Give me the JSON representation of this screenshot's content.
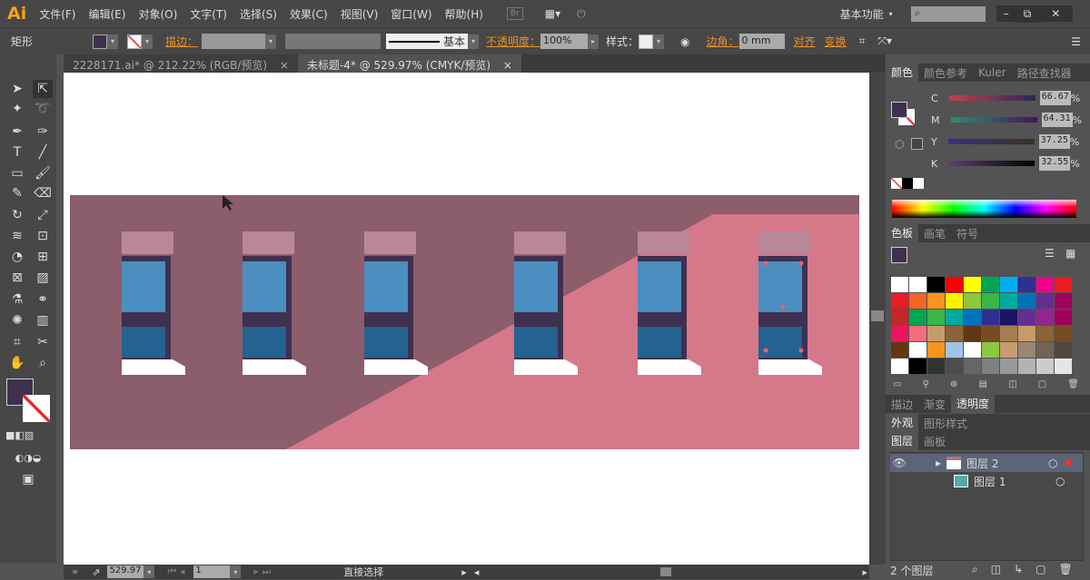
{
  "app": {
    "logo": "Ai",
    "menus": [
      "文件(F)",
      "编辑(E)",
      "对象(O)",
      "文字(T)",
      "选择(S)",
      "效果(C)",
      "视图(V)",
      "窗口(W)",
      "帮助(H)"
    ],
    "bridge": "Br",
    "workspace": "基本功能",
    "search_placeholder": ""
  },
  "control": {
    "object_type": "矩形",
    "stroke_label": "描边：",
    "brush": "基本",
    "opacity_label": "不透明度：",
    "opacity": "100%",
    "style_label": "样式：",
    "corner_label": "边角：",
    "corner_value": "0 mm",
    "align": "对齐",
    "transform": "变换"
  },
  "tabs": [
    {
      "label": "2228171.ai* @ 212.22% (RGB/预览)",
      "close": "×"
    },
    {
      "label": "未标题-4* @ 529.97% (CMYK/预览)",
      "close": "×"
    }
  ],
  "color_panel": {
    "tabs": [
      "颜色",
      "颜色参考",
      "Kuler",
      "路径查找器"
    ],
    "channels": [
      {
        "name": "C",
        "value": "66.67",
        "pct": "%"
      },
      {
        "name": "M",
        "value": "64.31",
        "pct": "%"
      },
      {
        "name": "Y",
        "value": "37.25",
        "pct": "%"
      },
      {
        "name": "K",
        "value": "32.55",
        "pct": "%"
      }
    ],
    "fill": "#3f3050"
  },
  "swatch_panel": {
    "tabs": [
      "色板",
      "画笔",
      "符号"
    ],
    "colors": [
      "#ffffff",
      "#ffffff",
      "#000000",
      "#ff0000",
      "#ffff00",
      "#00a651",
      "#00aeef",
      "#2e3192",
      "#ec008c",
      "#ed1c24",
      "#ed1c24",
      "#f26522",
      "#f7941d",
      "#fff200",
      "#8dc63f",
      "#39b54a",
      "#00a99d",
      "#0072bc",
      "#662d91",
      "#9e005d",
      "#c1272d",
      "#00a651",
      "#39b54a",
      "#00a99d",
      "#0072bc",
      "#2e3192",
      "#1b1464",
      "#662d91",
      "#92278f",
      "#9e005d",
      "#ed145b",
      "#f26d7d",
      "#c69c6d",
      "#8c6239",
      "#603813",
      "#754c24",
      "#a67c52",
      "#c69c6d",
      "#8c6239",
      "#754c24",
      "#603813",
      "#ffffff",
      "#f7941d",
      "#a0c4e8",
      "#ffffff",
      "#8dc63f",
      "#c69c6d",
      "#998675",
      "#736357",
      "#534741",
      "#ffffff",
      "#000000",
      "#333333",
      "#4d4d4d",
      "#666666",
      "#808080",
      "#999999",
      "#b3b3b3",
      "#cccccc",
      "#e6e6e6"
    ]
  },
  "small_panels": {
    "tabs1": [
      "描边",
      "渐变",
      "透明度"
    ],
    "tabs2": [
      "外观",
      "图形样式"
    ],
    "tabs3": [
      "图层",
      "画板"
    ]
  },
  "layers": [
    {
      "name": "图层 2"
    },
    {
      "name": "图层 1"
    }
  ],
  "layer_count": "2 个图层",
  "status": {
    "zoom": "529.97",
    "artboard": "1",
    "tool": "直接选择"
  },
  "artwork": {
    "wall_dark": "#8c5d6b",
    "wall_light": "#d4788a",
    "window_top": "#b8879a",
    "frame": "#3f3050",
    "glass_top": "#4a8fbf",
    "glass_bottom": "#24628f",
    "sill": "#ffffff"
  }
}
